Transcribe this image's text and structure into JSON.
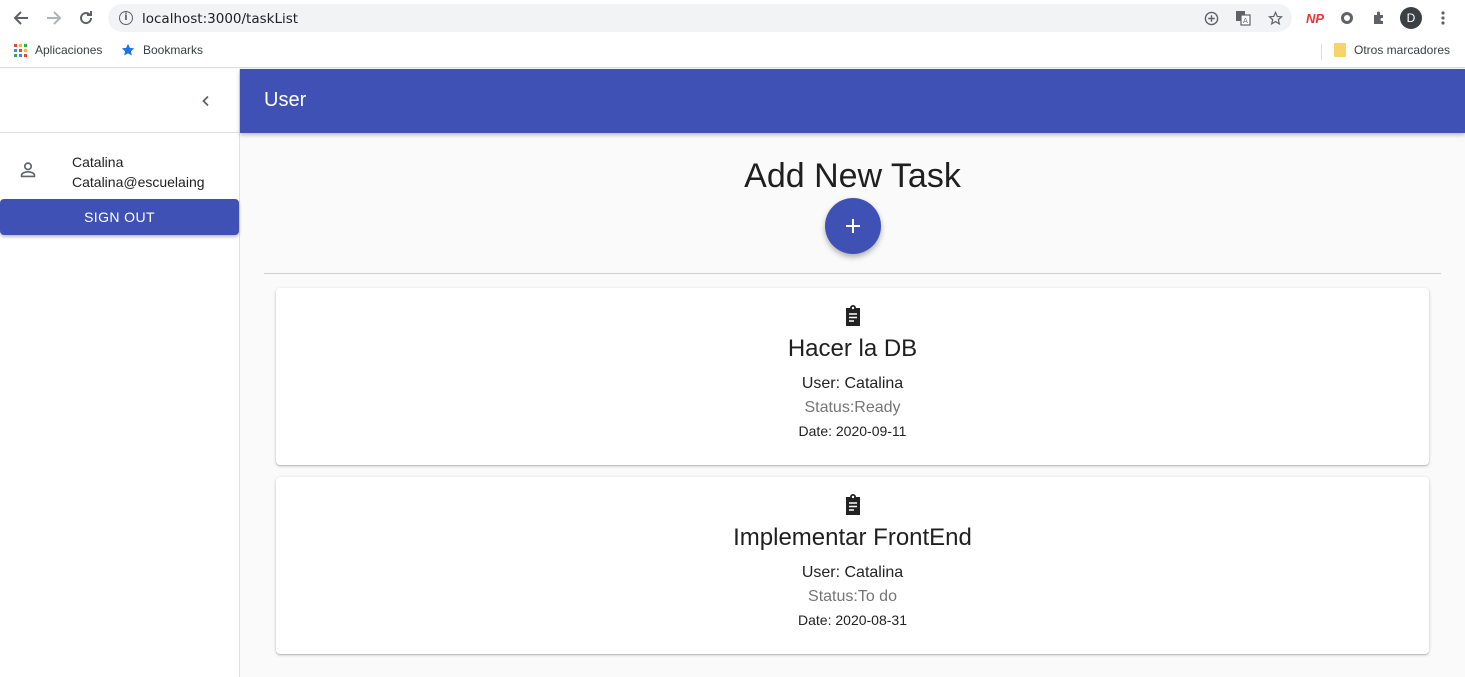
{
  "browser": {
    "url": "localhost:3000/taskList",
    "bookmarks": [
      "Aplicaciones",
      "Bookmarks"
    ],
    "other_bookmarks": "Otros marcadores",
    "ext_np": "NP",
    "profile_initial": "D"
  },
  "sidebar": {
    "user_name": "Catalina",
    "user_email": "Catalina@escuelaing",
    "signout_label": "SIGN OUT"
  },
  "appbar": {
    "title": "User"
  },
  "main": {
    "add_title": "Add New Task",
    "tasks": [
      {
        "title": "Hacer la DB",
        "user": "User: Catalina",
        "status": "Status:Ready",
        "date": "Date: 2020-09-11"
      },
      {
        "title": "Implementar FrontEnd",
        "user": "User: Catalina",
        "status": "Status:To do",
        "date": "Date: 2020-08-31"
      }
    ]
  },
  "colors": {
    "primary": "#3f51b5",
    "background": "#fafafa"
  }
}
